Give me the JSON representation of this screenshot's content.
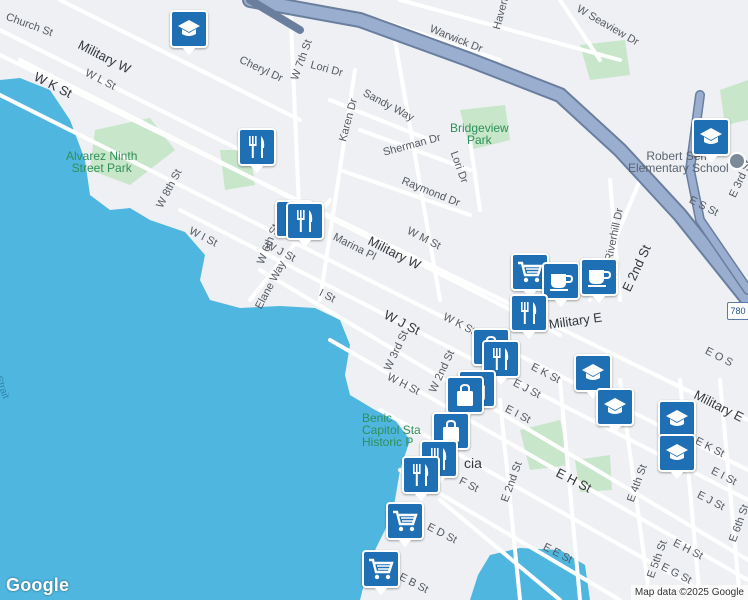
{
  "map": {
    "colors": {
      "water": "#4fb6e0",
      "land": "#eef0f3",
      "park": "#c8e6c9",
      "road": "#ffffff",
      "highway": "#8fa3c2",
      "highway_edge": "#6a7f9e",
      "pin": "#1f6fb4"
    },
    "streets": {
      "church_st": "Church St",
      "military_w": "Military W",
      "w_k_st": "W K St",
      "w_l_st": "W L St",
      "cheryl_dr": "Cheryl Dr",
      "w_7th_st": "W 7th St",
      "lori_dr_top": "Lori Dr",
      "warwick_dr": "Warwick Dr",
      "haven": "Haven",
      "w_seaview_dr": "W Seaview Dr",
      "karen_dr": "Karen Dr",
      "sandy_way": "Sandy Way",
      "sherman_dr": "Sherman Dr",
      "lori_dr": "Lori Dr",
      "raymond_dr": "Raymond Dr",
      "w_8th_st": "W 8th St",
      "w_i_st": "W I St",
      "w_6th_st": "W 6th St",
      "w_j_st_small": "W J St",
      "marina_pl": "Marina Pl",
      "military_w_2": "Military W",
      "w_m_st": "W M St",
      "elane_way": "Elane Way",
      "i_st": "I St",
      "w_j_st": "W J St",
      "w_k_st_2": "W K St",
      "military_e": "Military E",
      "w_3rd_st": "W 3rd St",
      "w_2nd_st": "W 2nd St",
      "w_h_st": "W H St",
      "e_k_st": "E K St",
      "e_j_st": "E J St",
      "e_i_st": "E I St",
      "riverhill_dr": "Riverhill Dr",
      "e_2nd_st_top": "E 2nd St",
      "e_s_st": "E S St",
      "e_3rd_st_r": "E 3rd St",
      "e_o_st": "E O S",
      "military_e_2": "Military E",
      "e_h_st": "E H St",
      "e_2nd_st": "E 2nd St",
      "e_4th_st": "E 4th St",
      "e_j_st_2": "E J St",
      "e_5th_st": "E 5th St",
      "e_h_st_2": "E H St",
      "e_g_st": "E G St",
      "e_6th_st": "E 6th St",
      "f_st": "F St",
      "e_d_st": "E D St",
      "e_e_st": "E E St",
      "e_b_st": "E B St",
      "i_st_ext": "E I St",
      "e_k_st_2": "E K St"
    },
    "places": {
      "alvarez_park": "Alvarez Ninth\nStreet Park",
      "bridgeview_park": "Bridgeview\nPark",
      "school": "Robert Sem\nElementary School",
      "capitol": "Benic\nCapitol Sta\nHistoric P",
      "city": "cia",
      "strait": "Strait"
    },
    "highway_shield": "780",
    "google_logo": "Google",
    "attribution": "Map data ©2025 Google",
    "pins": [
      {
        "type": "school-icon"
      },
      {
        "type": "restaurant-icon"
      },
      {
        "type": "restaurant-icon"
      },
      {
        "type": "restaurant-icon"
      },
      {
        "type": "shopping-cart-icon"
      },
      {
        "type": "coffee-icon"
      },
      {
        "type": "coffee-icon"
      },
      {
        "type": "restaurant-icon"
      },
      {
        "type": "school-icon"
      },
      {
        "type": "school-icon"
      },
      {
        "type": "school-icon"
      },
      {
        "type": "school-icon"
      },
      {
        "type": "school-icon"
      },
      {
        "type": "shopping-bag-icon"
      },
      {
        "type": "restaurant-icon"
      },
      {
        "type": "shopping-bag-icon"
      },
      {
        "type": "shopping-bag-icon"
      },
      {
        "type": "shopping-bag-icon"
      },
      {
        "type": "restaurant-icon"
      },
      {
        "type": "restaurant-icon"
      },
      {
        "type": "shopping-cart-icon"
      },
      {
        "type": "shopping-cart-icon"
      }
    ]
  }
}
